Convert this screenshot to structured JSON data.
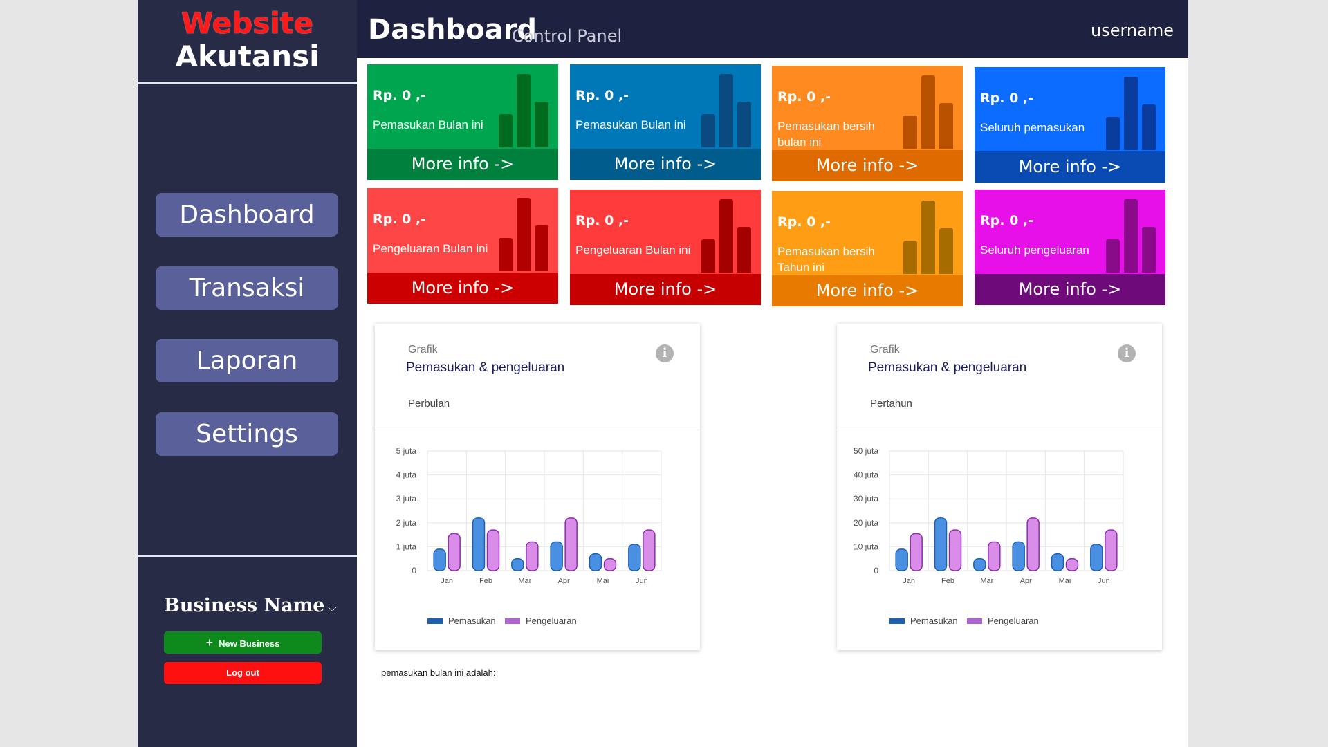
{
  "sidebar": {
    "logo_line1": "Website",
    "logo_line2": "Akutansi",
    "nav": [
      {
        "label": "Dashboard"
      },
      {
        "label": "Transaksi"
      },
      {
        "label": "Laporan"
      },
      {
        "label": "Settings"
      }
    ],
    "business_name": "Business Name",
    "chevron": "⌵",
    "new_business_label": "New Business",
    "new_business_icon": "+",
    "logout_label": "Log out"
  },
  "header": {
    "title": "Dashboard",
    "subtitle": "Control Panel",
    "username": "username"
  },
  "cards": [
    {
      "amount": "Rp. 0 ,-",
      "label": "Pemasukan Bulan ini",
      "more": "More info ->",
      "color": "#00a550",
      "dark": "#00803d",
      "bar": "#006b1f"
    },
    {
      "amount": "Rp. 0 ,-",
      "label": "Pemasukan Bulan ini",
      "more": "More info ->",
      "color": "#0078b8",
      "dark": "#005c8c",
      "bar": "#0a4a80"
    },
    {
      "amount": "Rp. 0 ,-",
      "label": "Pemasukan bersih bulan ini",
      "more": "More info ->",
      "color": "#ff8a1f",
      "dark": "#df6b00",
      "bar": "#b85100"
    },
    {
      "amount": "Rp. 0 ,-",
      "label": "Seluruh pemasukan",
      "more": "More info ->",
      "color": "#0b6cff",
      "dark": "#0a4ab3",
      "bar": "#0a3c9e"
    },
    {
      "amount": "Rp. 0 ,-",
      "label": "Pengeluaran Bulan ini",
      "more": "More info ->",
      "color": "#ff4646",
      "dark": "#cc0000",
      "bar": "#b00000"
    },
    {
      "amount": "Rp. 0 ,-",
      "label": "Pengeluaran Bulan ini",
      "more": "More info ->",
      "color": "#ff3b3b",
      "dark": "#c60000",
      "bar": "#a50000"
    },
    {
      "amount": "Rp. 0 ,-",
      "label": "Pemasukan bersih Tahun ini",
      "more": "More info ->",
      "color": "#ff9d14",
      "dark": "#e87a00",
      "bar": "#a76c00"
    },
    {
      "amount": "Rp. 0 ,-",
      "label": "Seluruh pengeluaran",
      "more": "More info ->",
      "color": "#e810e8",
      "dark": "#6e0a7a",
      "bar": "#8a0b8a"
    }
  ],
  "panels": [
    {
      "grafik": "Grafik",
      "title": "Pemasukan & pengeluaran",
      "period": "Perbulan",
      "info": "i"
    },
    {
      "grafik": "Grafik",
      "title": "Pemasukan & pengeluaran",
      "period": "Pertahun",
      "info": "i"
    }
  ],
  "footer_note": "pemasukan bulan ini adalah:",
  "chart_data": [
    {
      "type": "bar",
      "categories": [
        "Jan",
        "Feb",
        "Mar",
        "Apr",
        "Mai",
        "Jun"
      ],
      "y_ticks": [
        "0",
        "1  juta",
        "2  juta",
        "3 juta",
        "4 juta",
        "5 juta"
      ],
      "ylim": [
        0,
        5
      ],
      "series": [
        {
          "name": "Pemasukan",
          "values": [
            0.9,
            2.2,
            0.5,
            1.2,
            0.7,
            1.1
          ],
          "color": "#4a90e2"
        },
        {
          "name": "Pengeluaran",
          "values": [
            1.55,
            1.7,
            1.2,
            2.2,
            0.5,
            1.7
          ],
          "color": "#d98ce8"
        }
      ]
    },
    {
      "type": "bar",
      "categories": [
        "Jan",
        "Feb",
        "Mar",
        "Apr",
        "Mai",
        "Jun"
      ],
      "y_ticks": [
        "0",
        "10 juta",
        "20 juta",
        "30 juta",
        "40 juta",
        "50 juta"
      ],
      "ylim": [
        0,
        50
      ],
      "series": [
        {
          "name": "Pemasukan",
          "values": [
            9,
            22,
            5,
            12,
            7,
            11
          ],
          "color": "#4a90e2"
        },
        {
          "name": "Pengeluaran",
          "values": [
            15.5,
            17,
            12,
            22,
            5,
            17
          ],
          "color": "#d98ce8"
        }
      ]
    }
  ]
}
